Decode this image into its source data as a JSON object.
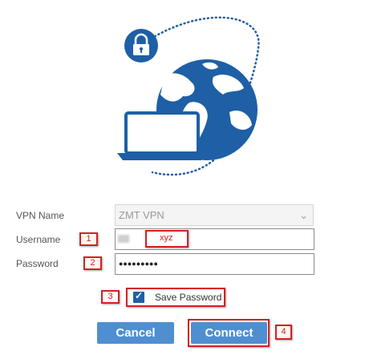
{
  "form": {
    "vpn_name_label": "VPN Name",
    "vpn_name_value": "ZMT VPN",
    "username_label": "Username",
    "username_value": "xyz",
    "password_label": "Password",
    "password_value": "●●●●●●●●●",
    "save_password_label": "Save Password",
    "save_password_checked": true
  },
  "buttons": {
    "cancel": "Cancel",
    "connect": "Connect"
  },
  "annotations": [
    "1",
    "2",
    "3",
    "4"
  ],
  "colors": {
    "brand_blue": "#1e5fa6",
    "button_blue": "#4f8fd1",
    "annotation_red": "#d32020"
  },
  "icons": {
    "hero": [
      "lock-icon",
      "globe-icon",
      "laptop-icon"
    ],
    "select": "chevron-down-icon",
    "checkbox": "checkmark-icon"
  }
}
